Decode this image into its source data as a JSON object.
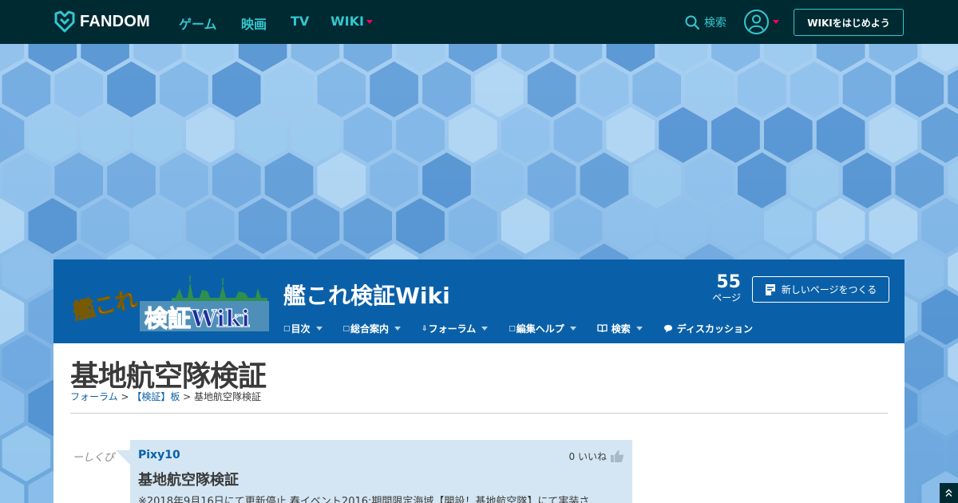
{
  "global_nav": {
    "logo_text": "FANDOM",
    "links": [
      {
        "label": "ゲーム"
      },
      {
        "label": "映画"
      },
      {
        "label": "TV"
      },
      {
        "label": "WIKI"
      }
    ],
    "search_label": "検索",
    "start_wiki_label": "WIKIをはじめよう",
    "colors": {
      "bar": "#002a32",
      "accent": "#35c6ce",
      "caret": "#fa005a"
    }
  },
  "wiki_header": {
    "logo_line1": "艦これ",
    "logo_line2": "検証Wiki",
    "title": "艦これ検証Wiki",
    "page_count": "55",
    "page_count_label": "ページ",
    "new_page_label": "新しいページをつくる",
    "nav": [
      {
        "prefix": "□",
        "label": "目次",
        "icon": "doc-icon"
      },
      {
        "prefix": "□",
        "label": "総合案内",
        "icon": "doc-icon"
      },
      {
        "prefix": "⇩",
        "label": "フォーラム",
        "icon": "forum-icon"
      },
      {
        "prefix": "□",
        "label": "編集ヘルプ",
        "icon": "doc-icon"
      },
      {
        "prefix": "",
        "label": "検索",
        "icon": "book-icon"
      },
      {
        "prefix": "",
        "label": "ディスカッション",
        "icon": "chat-bubble-icon"
      }
    ],
    "color": "#0a60a8"
  },
  "page": {
    "heading": "基地航空隊検証",
    "breadcrumb": {
      "forum": "フォーラム",
      "sep1": " > ",
      "board": "【検証】板",
      "sep2": " > ",
      "current": "基地航空隊検証"
    }
  },
  "post": {
    "signature": "ーしくぴ",
    "username": "Pixy10",
    "likes": "0 いいね",
    "title": "基地航空隊検証",
    "body": "※2018年9月16日にて更新停止 春イベント2016:期間限定海域【開設！基地航空隊】にて実装さ"
  }
}
